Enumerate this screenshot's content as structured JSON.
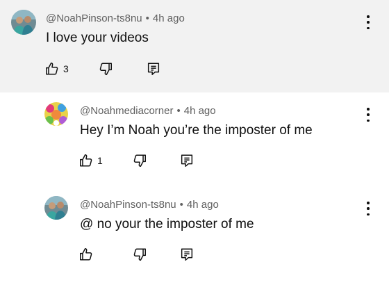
{
  "colors": {
    "highlight_bg": "#f2f2f2",
    "meta_text": "#606060",
    "text": "#0f0f0f"
  },
  "comments": [
    {
      "author": "@NoahPinson-ts8nu",
      "separator": "•",
      "time": "4h ago",
      "text": "I love your videos",
      "likes": "3",
      "icons": [
        "like-icon",
        "dislike-icon",
        "reply-icon",
        "more-vert-icon"
      ]
    },
    {
      "author": "@Noahmediacorner",
      "separator": "•",
      "time": "4h ago",
      "text": "Hey I’m Noah you’re the imposter of me",
      "likes": "1",
      "icons": [
        "like-icon",
        "dislike-icon",
        "reply-icon",
        "more-vert-icon"
      ]
    },
    {
      "author": "@NoahPinson-ts8nu",
      "separator": "•",
      "time": "4h ago",
      "text": "@ no your the imposter of me",
      "likes": "",
      "icons": [
        "like-icon",
        "dislike-icon",
        "reply-icon",
        "more-vert-icon"
      ]
    }
  ]
}
